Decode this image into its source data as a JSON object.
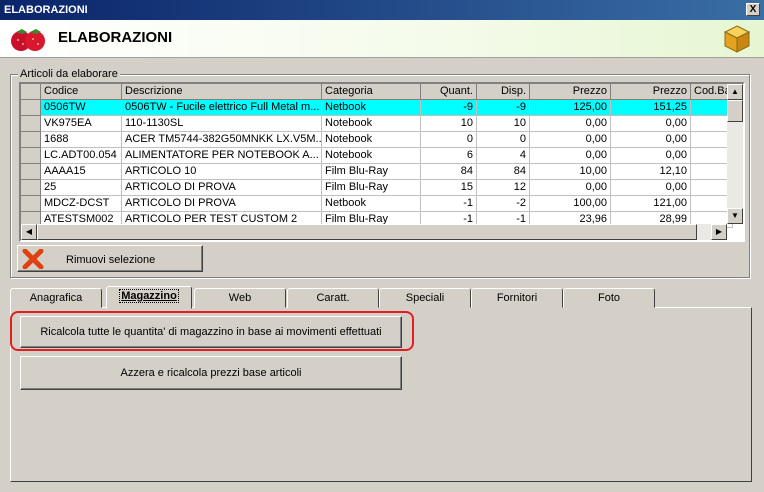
{
  "window": {
    "title": "ELABORAZIONI",
    "close_label": "X"
  },
  "header": {
    "title": "ELABORAZIONI"
  },
  "group": {
    "legend": "Articoli da elaborare"
  },
  "grid": {
    "columns": [
      "Codice",
      "Descrizione",
      "Categoria",
      "Quant.",
      "Disp.",
      "Prezzo",
      "Prezzo",
      "Cod.Barre"
    ],
    "rows": [
      [
        "0506TW",
        "0506TW  - Fucile elettrico Full Metal m...",
        "Netbook",
        "-9",
        "-9",
        "125,00",
        "151,25",
        ""
      ],
      [
        "VK975EA",
        "110-1130SL",
        "Notebook",
        "10",
        "10",
        "0,00",
        "0,00",
        ""
      ],
      [
        "1688",
        "ACER TM5744-382G50MNKK LX.V5M...",
        "Notebook",
        "0",
        "0",
        "0,00",
        "0,00",
        ""
      ],
      [
        "LC.ADT00.054",
        "ALIMENTATORE PER NOTEBOOK A...",
        "Notebook",
        "6",
        "4",
        "0,00",
        "0,00",
        ""
      ],
      [
        "AAAA15",
        "ARTICOLO 10",
        "Film Blu-Ray",
        "84",
        "84",
        "10,00",
        "12,10",
        ""
      ],
      [
        "25",
        "ARTICOLO DI PROVA",
        "Film Blu-Ray",
        "15",
        "12",
        "0,00",
        "0,00",
        ""
      ],
      [
        "MDCZ-DCST",
        "ARTICOLO DI PROVA",
        "Netbook",
        "-1",
        "-2",
        "100,00",
        "121,00",
        ""
      ],
      [
        "ATESTSM002",
        "ARTICOLO PER TEST CUSTOM 2",
        "Film Blu-Ray",
        "-1",
        "-1",
        "23,96",
        "28,99",
        ""
      ]
    ],
    "selected_row": 0
  },
  "remove_button": {
    "label": "Rimuovi selezione"
  },
  "tabs": [
    "Anagrafica",
    "Magazzino",
    "Web",
    "Caratt.",
    "Speciali",
    "Fornitori",
    "Foto"
  ],
  "active_tab": 1,
  "actions": {
    "recalc_qty": "Ricalcola tutte le quantita' di magazzino in base ai movimenti effettuati",
    "reset_prices": "Azzera e ricalcola prezzi base articoli"
  },
  "colors": {
    "selected_row": "#00ffff",
    "highlight": "#e02020",
    "title_bar": "#0a246a"
  }
}
